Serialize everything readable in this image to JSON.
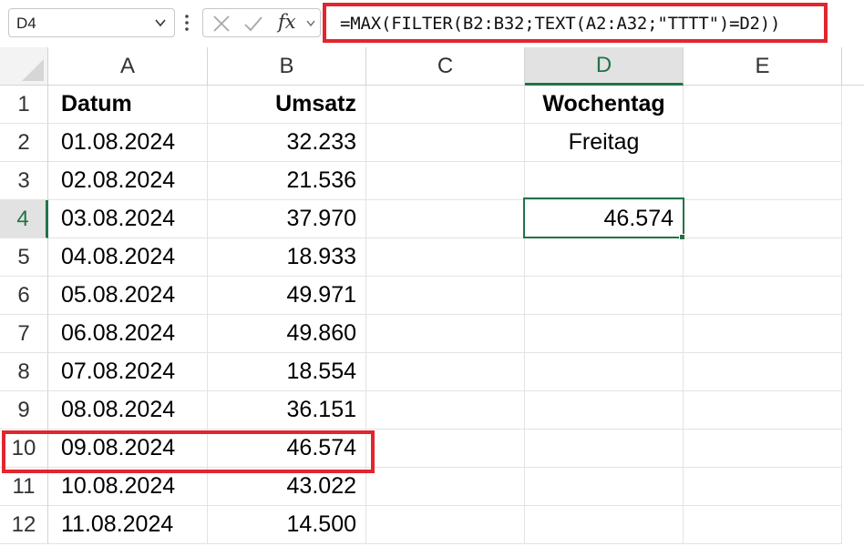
{
  "formula_bar": {
    "name_box": "D4",
    "fx_label": "fx",
    "formula": "=MAX(FILTER(B2:B32;TEXT(A2:A32;\"TTTT\")=D2))"
  },
  "columns": [
    "A",
    "B",
    "C",
    "D",
    "E"
  ],
  "active_cell": "D4",
  "rows": [
    {
      "num": "1",
      "A": "Datum",
      "B": "Umsatz",
      "D": "Wochentag"
    },
    {
      "num": "2",
      "A": "01.08.2024",
      "B": "32.233",
      "D": "Freitag"
    },
    {
      "num": "3",
      "A": "02.08.2024",
      "B": "21.536",
      "D": ""
    },
    {
      "num": "4",
      "A": "03.08.2024",
      "B": "37.970",
      "D": "46.574"
    },
    {
      "num": "5",
      "A": "04.08.2024",
      "B": "18.933",
      "D": ""
    },
    {
      "num": "6",
      "A": "05.08.2024",
      "B": "49.971",
      "D": ""
    },
    {
      "num": "7",
      "A": "06.08.2024",
      "B": "49.860",
      "D": ""
    },
    {
      "num": "8",
      "A": "07.08.2024",
      "B": "18.554",
      "D": ""
    },
    {
      "num": "9",
      "A": "08.08.2024",
      "B": "36.151",
      "D": ""
    },
    {
      "num": "10",
      "A": "09.08.2024",
      "B": "46.574",
      "D": ""
    },
    {
      "num": "11",
      "A": "10.08.2024",
      "B": "43.022",
      "D": ""
    },
    {
      "num": "12",
      "A": "11.08.2024",
      "B": "14.500",
      "D": ""
    }
  ],
  "highlight": {
    "color": "#e1262e",
    "row": "10"
  },
  "accent_color": "#217346",
  "icons": {
    "name_box_dropdown": "chevron-down-icon",
    "more": "vertical-ellipsis-icon",
    "cancel": "close-icon",
    "enter": "checkmark-icon",
    "function": "fx-icon"
  }
}
